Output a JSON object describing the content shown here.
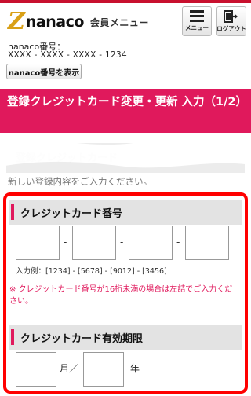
{
  "header": {
    "logo_mark": "Z",
    "logo_text": "nanaco",
    "subtitle": "会員メニュー",
    "menu_label": "メニュー",
    "logout_label": "ログアウト",
    "card_number_label": "nanaco番号：",
    "card_number_value": "XXXX - XXXX - XXXX - 1234",
    "show_button": "nanaco番号を表示"
  },
  "page": {
    "title": "登録クレジットカード変更・更新 入力（1/2）"
  },
  "faded": {
    "heading": "登録クレジットカード",
    "text": "新しい登録内容をご入力ください。"
  },
  "credit_card": {
    "heading": "クレジットカード番号",
    "separator": "-",
    "example": "入力例：[1234] - [5678] - [9012] - [3456]",
    "warning": "※ クレジットカード番号が16桁未満の場合は左詰でご入力ください。"
  },
  "expiry": {
    "heading": "クレジットカード有効期限",
    "month_label": "月／",
    "year_label": "年"
  },
  "colors": {
    "brand": "#e0195c",
    "highlight": "#ff0000"
  }
}
